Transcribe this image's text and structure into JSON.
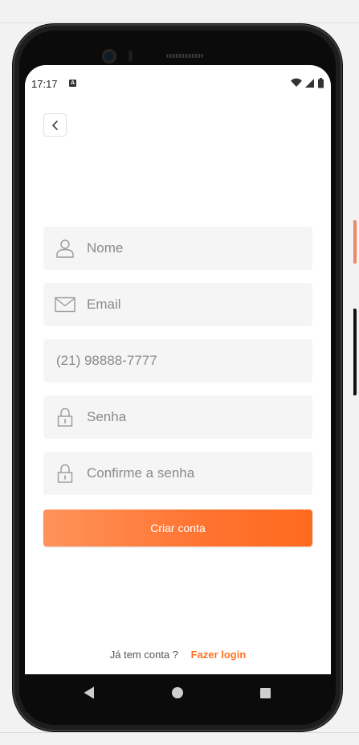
{
  "status_bar": {
    "time": "17:17",
    "notification_badge": "A",
    "icons": [
      "wifi-icon",
      "signal-icon",
      "battery-icon"
    ]
  },
  "header": {
    "back_icon": "chevron-left-icon"
  },
  "form": {
    "name": {
      "placeholder": "Nome",
      "value": "",
      "icon": "user-icon"
    },
    "email": {
      "placeholder": "Email",
      "value": "",
      "icon": "mail-icon"
    },
    "phone": {
      "placeholder": "(21) 98888-7777",
      "value": ""
    },
    "password": {
      "placeholder": "Senha",
      "value": "",
      "icon": "lock-icon"
    },
    "confirm_password": {
      "placeholder": "Confirme a senha",
      "value": "",
      "icon": "lock-icon"
    },
    "submit_label": "Criar conta"
  },
  "footer": {
    "question": "Já tem conta ?",
    "login_link": "Fazer login"
  },
  "colors": {
    "accent": "#ff7325",
    "button_gradient_start": "#ff935a",
    "button_gradient_end": "#ff6a1f",
    "field_background": "#f5f5f5",
    "placeholder": "#8a8a8a"
  },
  "nav_bar": {
    "icons": [
      "nav-back-icon",
      "nav-home-icon",
      "nav-recents-icon"
    ]
  }
}
